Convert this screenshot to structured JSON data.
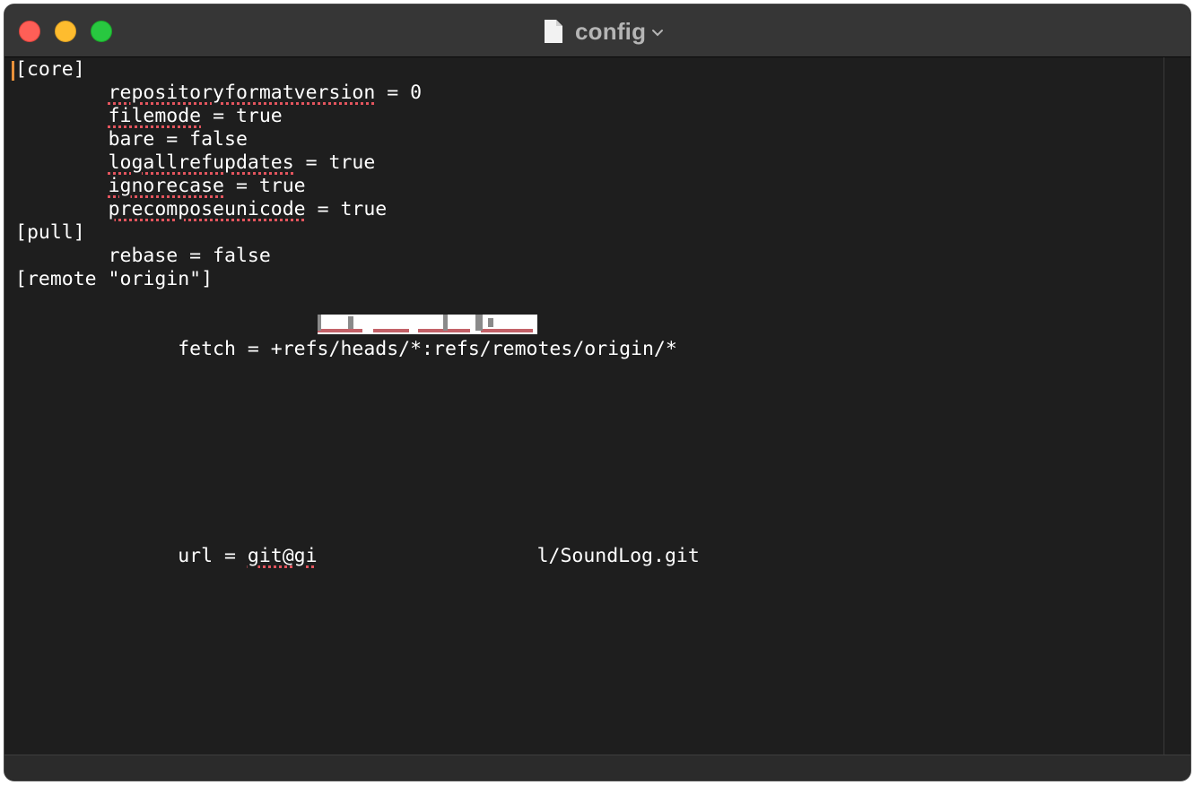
{
  "window": {
    "title": "config",
    "file_icon": "document-icon",
    "title_menu_icon": "chevron-down-icon",
    "traffic_lights": {
      "close_color": "#fe5f57",
      "minimize_color": "#febc2e",
      "zoom_color": "#28c840"
    }
  },
  "editor": {
    "background": "#1e1e1e",
    "text_color": "#ffffff",
    "caret_color": "#e8913a",
    "spellcheck_color": "#e3555e",
    "lines": [
      {
        "indent": "",
        "word": "",
        "rest": "[core]"
      },
      {
        "indent": "        ",
        "word": "repositoryformatversion",
        "rest": " = 0"
      },
      {
        "indent": "        ",
        "word": "filemode",
        "rest": " = true"
      },
      {
        "indent": "        ",
        "word": "",
        "rest": "bare = false"
      },
      {
        "indent": "        ",
        "word": "logallrefupdates",
        "rest": " = true"
      },
      {
        "indent": "        ",
        "word": "ignorecase",
        "rest": " = true"
      },
      {
        "indent": "        ",
        "word": "precomposeunicode",
        "rest": " = true"
      },
      {
        "indent": "",
        "word": "",
        "rest": "[pull]"
      },
      {
        "indent": "        ",
        "word": "",
        "rest": "rebase = false"
      },
      {
        "indent": "",
        "word": "",
        "rest": "[remote \"origin\"]"
      }
    ],
    "url_line": {
      "prefix": "        url = ",
      "visible_start": "git@gi",
      "redacted": true,
      "visible_end": "l/SoundLog.git"
    },
    "fetch_line": {
      "text": "        fetch = +refs/heads/*:refs/remotes/origin/*"
    }
  }
}
